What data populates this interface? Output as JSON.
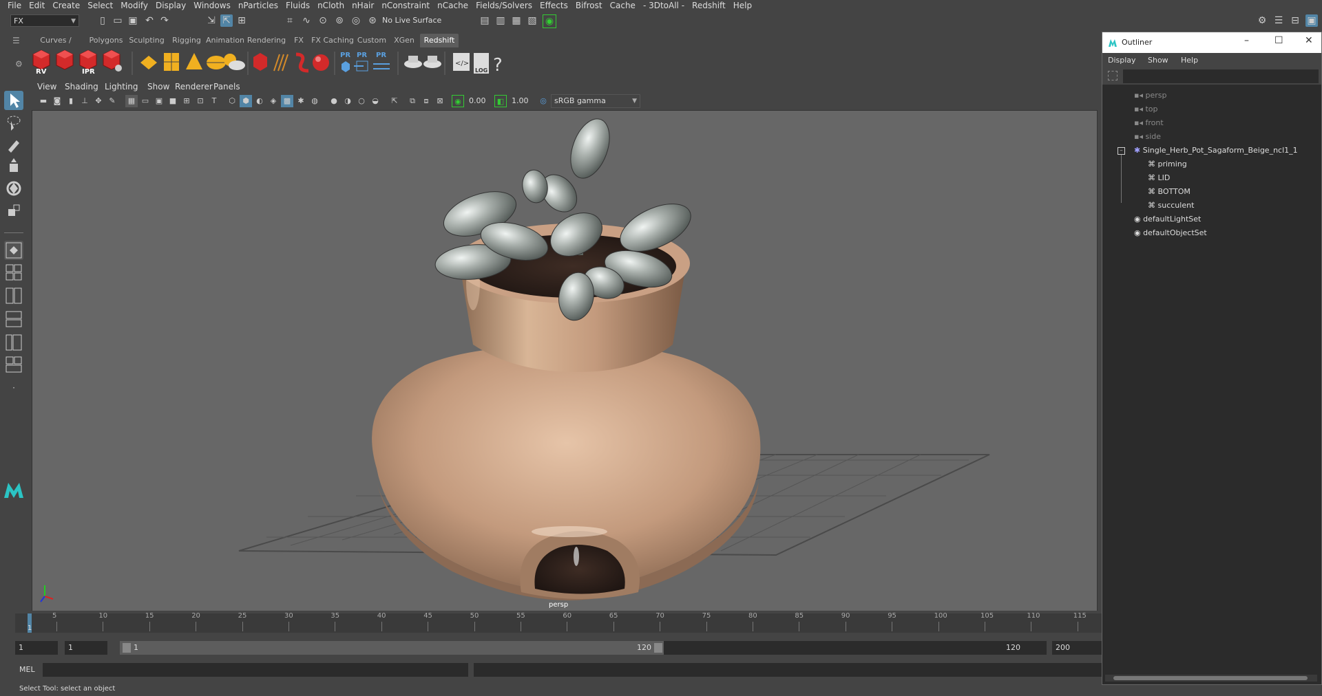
{
  "menubar": {
    "items": [
      "File",
      "Edit",
      "Create",
      "Select",
      "Modify",
      "Display",
      "Windows",
      "nParticles",
      "Fluids",
      "nCloth",
      "nHair",
      "nConstraint",
      "nCache",
      "Fields/Solvers",
      "Effects",
      "Bifrost",
      "Cache",
      "- 3DtoAll -",
      "Redshift",
      "Help"
    ]
  },
  "statusline": {
    "menuset": "FX",
    "live_surface": "No Live Surface"
  },
  "shelf": {
    "tabs": [
      "Curves / Surfaces",
      "Polygons",
      "Sculpting",
      "Rigging",
      "Animation",
      "Rendering",
      "FX",
      "FX Caching",
      "Custom",
      "XGen",
      "Redshift"
    ],
    "active_tab": "Redshift",
    "icon_labels": {
      "rv": "RV",
      "ipr": "IPR",
      "pr1": "PR",
      "pr2": "PR",
      "pr3": "PR",
      "log": "LOG",
      "help": "?"
    }
  },
  "viewport": {
    "menu": [
      "View",
      "Shading",
      "Lighting",
      "Show",
      "Renderer",
      "Panels"
    ],
    "exposure": "0.00",
    "gamma": "1.00",
    "color_space": "sRGB gamma",
    "camera_label": "persp"
  },
  "timeline": {
    "ticks": [
      "5",
      "10",
      "15",
      "20",
      "25",
      "30",
      "35",
      "40",
      "45",
      "50",
      "55",
      "60",
      "65",
      "70",
      "75",
      "80",
      "85",
      "90",
      "95",
      "100",
      "105",
      "110",
      "115"
    ],
    "current_frame": "1"
  },
  "range": {
    "start": "1",
    "anim_start": "1",
    "slider_start": "1",
    "slider_end": "120",
    "playback_end": "120",
    "anim_end": "200"
  },
  "command": {
    "mel_label": "MEL"
  },
  "helpline": {
    "text": "Select Tool: select an object"
  },
  "outliner": {
    "title": "Outliner",
    "menu": [
      "Display",
      "Show",
      "Help"
    ],
    "cameras": [
      "persp",
      "top",
      "front",
      "side"
    ],
    "group": "Single_Herb_Pot_Sagaform_Beige_ncl1_1",
    "children": [
      "priming",
      "LID",
      "BOTTOM",
      "succulent"
    ],
    "sets": [
      "defaultLightSet",
      "defaultObjectSet"
    ]
  },
  "colors": {
    "accent": "#5285a6",
    "pot": "#c39a7d",
    "soil": "#3a2a22",
    "leaf": "#a9b0ac"
  }
}
